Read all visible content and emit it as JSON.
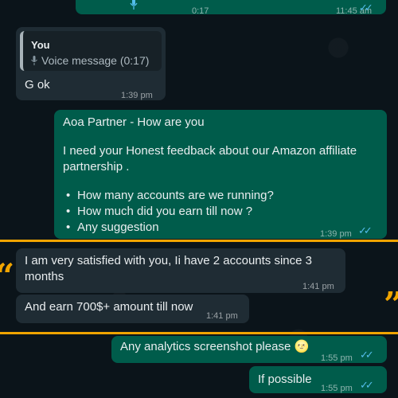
{
  "top_voice": {
    "duration": "0:17",
    "time": "11:45 am"
  },
  "reply_msg": {
    "quote_author": "You",
    "quote_text": "Voice message (0:17)",
    "text": "G ok",
    "time": "1:39 pm"
  },
  "question_msg": {
    "line1": "Aoa Partner  - How are you",
    "line2": "I need your Honest feedback about our Amazon affiliate partnership .",
    "bullets": [
      "How many accounts are we running?",
      "How much did you earn till now ?",
      "Any suggestion"
    ],
    "time": "1:39 pm"
  },
  "answer_msg1": {
    "text": "I am very satisfied with you, Ii have 2 accounts since 3 months",
    "time": "1:41 pm"
  },
  "answer_msg2": {
    "text": "And earn 700$+ amount till now",
    "time": "1:41 pm"
  },
  "analytics_msg": {
    "text": "Any analytics screenshot please",
    "emoji": "🌝",
    "time": "1:55 pm"
  },
  "possible_msg": {
    "text": "If possible",
    "time": "1:55 pm"
  },
  "colors": {
    "background": "#0b141a",
    "incoming": "#1f2c34",
    "outgoing": "#005c4b",
    "read_ticks": "#53bdeb",
    "highlight": "#f0a400"
  },
  "icons": [
    "microphone-icon",
    "double-check-icon",
    "quote-mark-icon"
  ]
}
